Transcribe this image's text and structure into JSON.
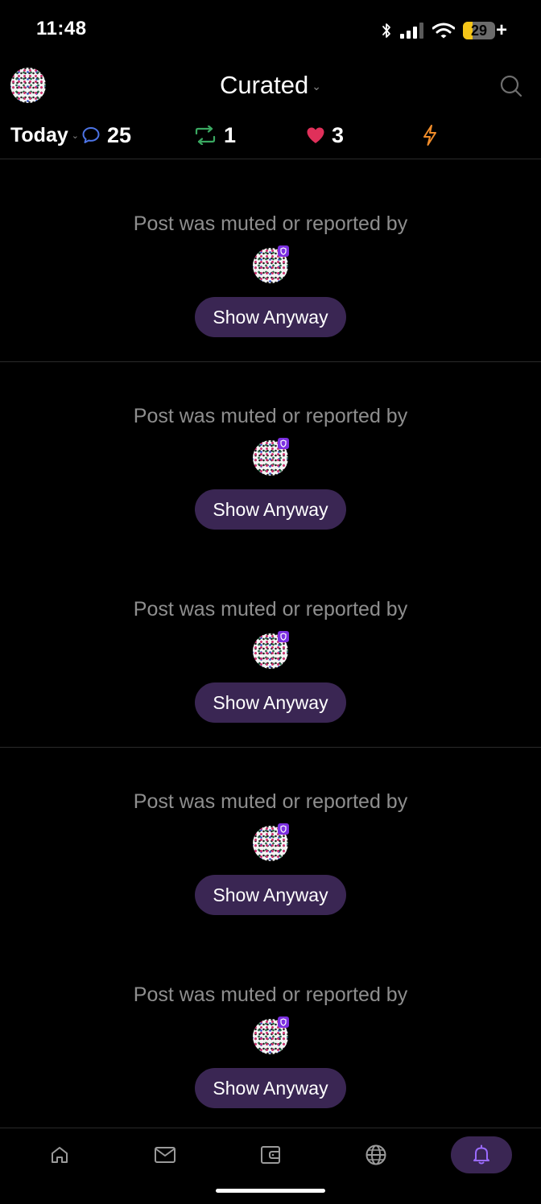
{
  "status_bar": {
    "time": "11:48",
    "battery_level": "29",
    "battery_percent": 29,
    "battery_color": "#f5c518",
    "icons": [
      "bluetooth-icon",
      "signal-icon",
      "wifi-icon",
      "battery-icon"
    ]
  },
  "header": {
    "title": "Curated",
    "avatar": "user-avatar",
    "search_icon": "search-icon"
  },
  "stats": {
    "period_label": "Today",
    "replies": {
      "icon": "reply-icon",
      "count": "25",
      "color": "#4d74e6"
    },
    "reposts": {
      "icon": "repost-icon",
      "count": "1",
      "color": "#3aa861"
    },
    "likes": {
      "icon": "heart-icon",
      "count": "3",
      "color": "#e0305a"
    },
    "zaps": {
      "icon": "zap-icon",
      "count": "",
      "color": "#f08c2a"
    }
  },
  "feed": {
    "items": [
      {
        "message": "Post was muted or reported by",
        "button_label": "Show Anyway"
      },
      {
        "message": "Post was muted or reported by",
        "button_label": "Show Anyway"
      },
      {
        "message": "Post was muted or reported by",
        "button_label": "Show Anyway"
      },
      {
        "message": "Post was muted or reported by",
        "button_label": "Show Anyway"
      },
      {
        "message": "Post was muted or reported by",
        "button_label": "Show Anyway"
      }
    ]
  },
  "bottom_nav": {
    "items": [
      {
        "name": "home",
        "icon": "home-icon"
      },
      {
        "name": "messages",
        "icon": "mail-icon"
      },
      {
        "name": "wallet",
        "icon": "wallet-icon"
      },
      {
        "name": "explore",
        "icon": "globe-icon"
      },
      {
        "name": "notifications",
        "icon": "bell-icon",
        "active": true
      }
    ],
    "active_color": "#3a2653",
    "accent": "#9b6bff"
  }
}
